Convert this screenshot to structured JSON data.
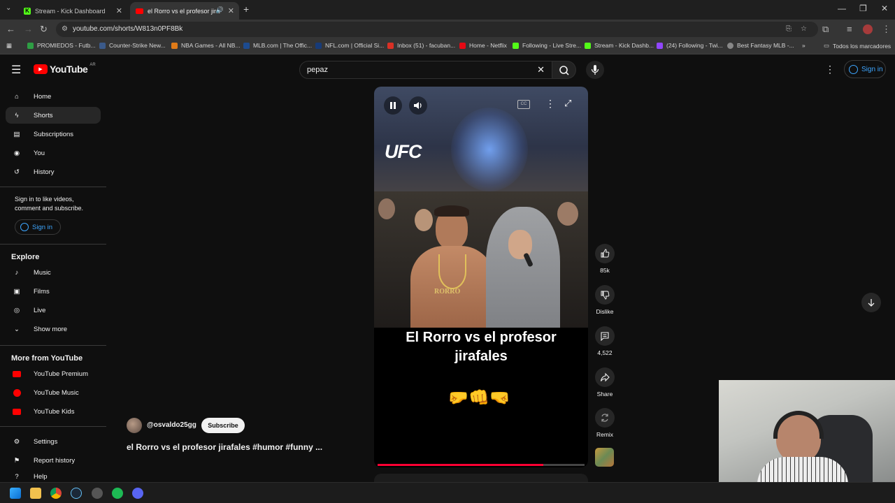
{
  "browser": {
    "tabs": [
      {
        "title": "Stream - Kick Dashboard",
        "active": false
      },
      {
        "title": "el Rorro vs el profesor jirafa",
        "active": true
      }
    ],
    "url": "youtube.com/shorts/W813n0PF8Bk",
    "bookmarks": [
      "PROMIEDOS - Futb...",
      "Counter-Strike New...",
      "NBA Games - All NB...",
      "MLB.com | The Offic...",
      "NFL.com | Official Si...",
      "Inbox (51) - facuban...",
      "Home - Netflix",
      "Following - Live Stre...",
      "Stream - Kick Dashb...",
      "(24) Following - Twi...",
      "Best Fantasy MLB -..."
    ],
    "bookmarks_folder": "Todos los marcadores"
  },
  "youtube": {
    "logo_text": "YouTube",
    "region": "AR",
    "search_value": "pepaz",
    "signin_label": "Sign in"
  },
  "sidebar": {
    "main": [
      {
        "label": "Home",
        "icon": "home-icon"
      },
      {
        "label": "Shorts",
        "icon": "shorts-icon",
        "active": true
      },
      {
        "label": "Subscriptions",
        "icon": "subscriptions-icon"
      },
      {
        "label": "You",
        "icon": "you-icon"
      },
      {
        "label": "History",
        "icon": "history-icon"
      }
    ],
    "signin_prompt": "Sign in to like videos, comment and subscribe.",
    "signin_button": "Sign in",
    "explore_title": "Explore",
    "explore": [
      {
        "label": "Music",
        "icon": "music-icon"
      },
      {
        "label": "Films",
        "icon": "films-icon"
      },
      {
        "label": "Live",
        "icon": "live-icon"
      },
      {
        "label": "Show more",
        "icon": "chevron-down-icon"
      }
    ],
    "more_title": "More from YouTube",
    "more": [
      {
        "label": "YouTube Premium"
      },
      {
        "label": "YouTube Music"
      },
      {
        "label": "YouTube Kids"
      }
    ],
    "footer": [
      {
        "label": "Settings",
        "icon": "settings-icon"
      },
      {
        "label": "Report history",
        "icon": "flag-icon"
      },
      {
        "label": "Help",
        "icon": "help-icon"
      }
    ]
  },
  "short": {
    "channel": "@osvaldo25gg",
    "subscribe_label": "Subscribe",
    "title": "el Rorro vs el profesor jirafales #humor #funny ...",
    "overlay_caption": "El Rorro vs el profesor jirafales",
    "brand_overlay": "UFC",
    "chest_text": "RORRO",
    "emojis": "🤛👊🤜",
    "progress": 0.8,
    "actions": {
      "likes": "85k",
      "dislike": "Dislike",
      "comments": "4,522",
      "share": "Share",
      "remix": "Remix"
    }
  },
  "colors": {
    "background": "#0f0f0f",
    "accent_red": "#ff0000",
    "link_blue": "#3ea6ff",
    "kick_green": "#53fc18"
  }
}
